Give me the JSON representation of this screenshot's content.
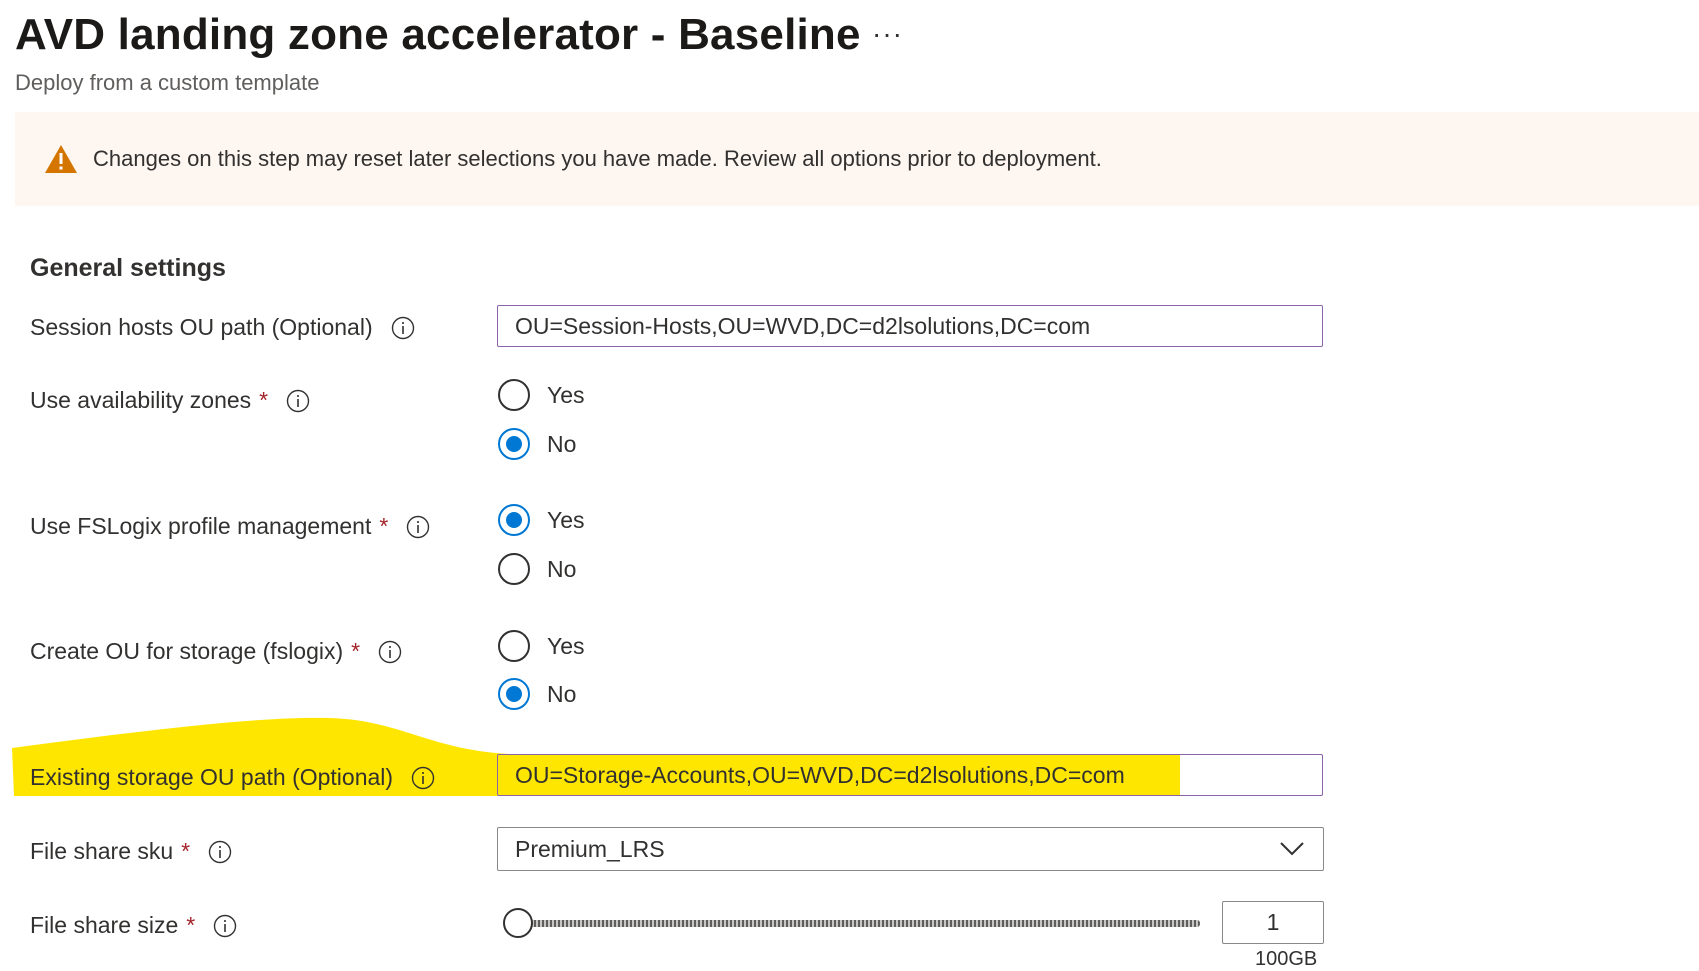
{
  "header": {
    "title": "AVD landing zone accelerator - Baseline",
    "more_label": "···",
    "subtitle": "Deploy from a custom template"
  },
  "banner": {
    "icon": "warning-icon",
    "message": "Changes on this step may reset later selections you have made. Review all options prior to deployment.",
    "color": "#d47500"
  },
  "section": {
    "title": "General settings"
  },
  "fields": {
    "session_hosts_ou": {
      "label": "Session hosts OU path (Optional)",
      "value": "OU=Session-Hosts,OU=WVD,DC=d2lsolutions,DC=com"
    },
    "availability_zones": {
      "label": "Use availability zones",
      "required": "*",
      "options": [
        "Yes",
        "No"
      ],
      "selected": "No"
    },
    "fslogix": {
      "label": "Use FSLogix profile management",
      "required": "*",
      "options": [
        "Yes",
        "No"
      ],
      "selected": "Yes"
    },
    "create_ou_storage": {
      "label": "Create OU for storage (fslogix)",
      "required": "*",
      "options": [
        "Yes",
        "No"
      ],
      "selected": "No"
    },
    "storage_ou": {
      "label": "Existing storage OU path (Optional)",
      "value": "OU=Storage-Accounts,OU=WVD,DC=d2lsolutions,DC=com"
    },
    "file_share_sku": {
      "label": "File share sku",
      "required": "*",
      "value": "Premium_LRS"
    },
    "file_share_size": {
      "label": "File share size",
      "required": "*",
      "value": "1",
      "slider_fraction": 0,
      "unit_label": "100GB"
    }
  },
  "colors": {
    "accent": "#0078d4",
    "highlight": "#ffe600",
    "required": "#a4262c",
    "focus_border": "#8a63a8"
  }
}
